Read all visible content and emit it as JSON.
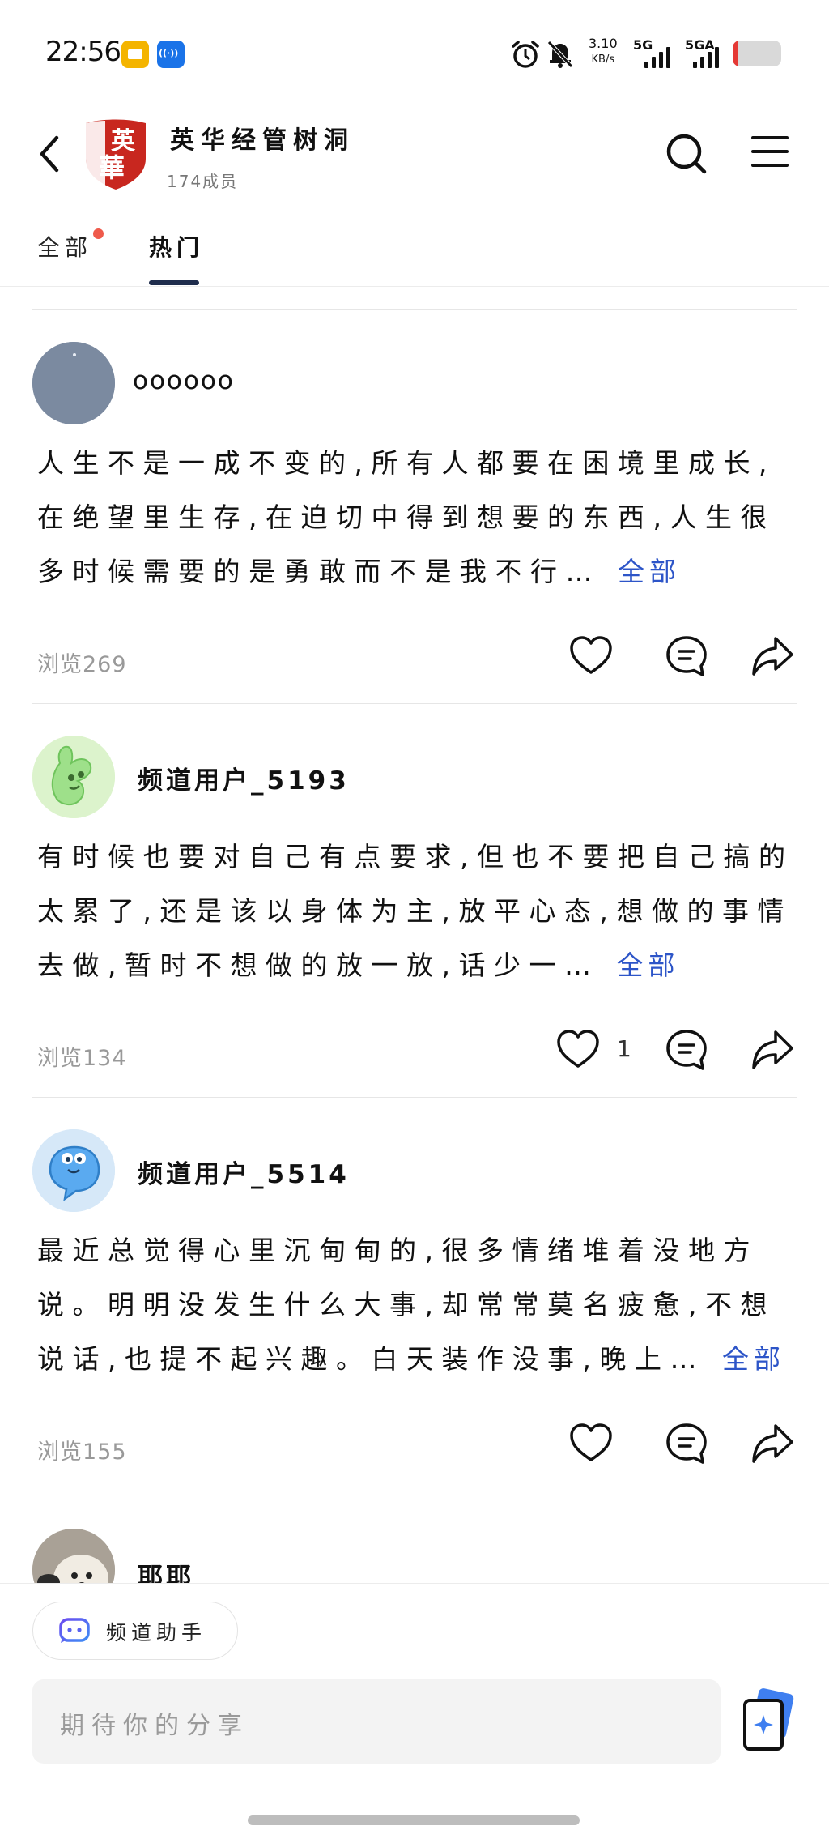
{
  "status_bar": {
    "time": "22:56",
    "net_speed_value": "3.10",
    "net_speed_unit": "KB/s",
    "signal_1_label": "5G",
    "signal_2_label": "5GA",
    "battery_level": 0.12,
    "battery_color": "#e53935",
    "icons": [
      "alarm-icon",
      "mute-bell-icon"
    ]
  },
  "header": {
    "back_icon": "chevron-left-icon",
    "logo_text_top": "英",
    "logo_text_bottom": "華",
    "group_name": "英华经管树洞",
    "members": "174成员",
    "search_icon": "search-icon",
    "menu_icon": "menu-icon"
  },
  "tabs": [
    {
      "label": "全部",
      "has_dot": true,
      "active": false
    },
    {
      "label": "热门",
      "has_dot": false,
      "active": true
    }
  ],
  "posts": [
    {
      "author": "oooooo",
      "body": "人生不是一成不变的,所有人都要在困境里成长,在绝望里生存,在迫切中得到想要的东西,人生很多时候需要的是勇敢而不是我不行…",
      "more": "全部",
      "views": "浏览269",
      "likes": ""
    },
    {
      "author": "频道用户_5193",
      "body": "有时候也要对自己有点要求,但也不要把自己搞的太累了,还是该以身体为主,放平心态,想做的事情去做,暂时不想做的放一放,话少一…",
      "more": "全部",
      "views": "浏览134",
      "likes": "1"
    },
    {
      "author": "频道用户_5514",
      "body": "最近总觉得心里沉甸甸的,很多情绪堆着没地方说。明明没发生什么大事,却常常莫名疲惫,不想说话,也提不起兴趣。白天装作没事,晚上…",
      "more": "全部",
      "views": "浏览155",
      "likes": ""
    },
    {
      "author": "耶耶"
    }
  ],
  "bottom": {
    "assistant_label": "频道助手",
    "input_placeholder": "期待你的分享"
  },
  "colors": {
    "accent_link": "#2d55c8",
    "tab_underline": "#1f2d4d",
    "notification_dot": "#ef5a4b"
  }
}
